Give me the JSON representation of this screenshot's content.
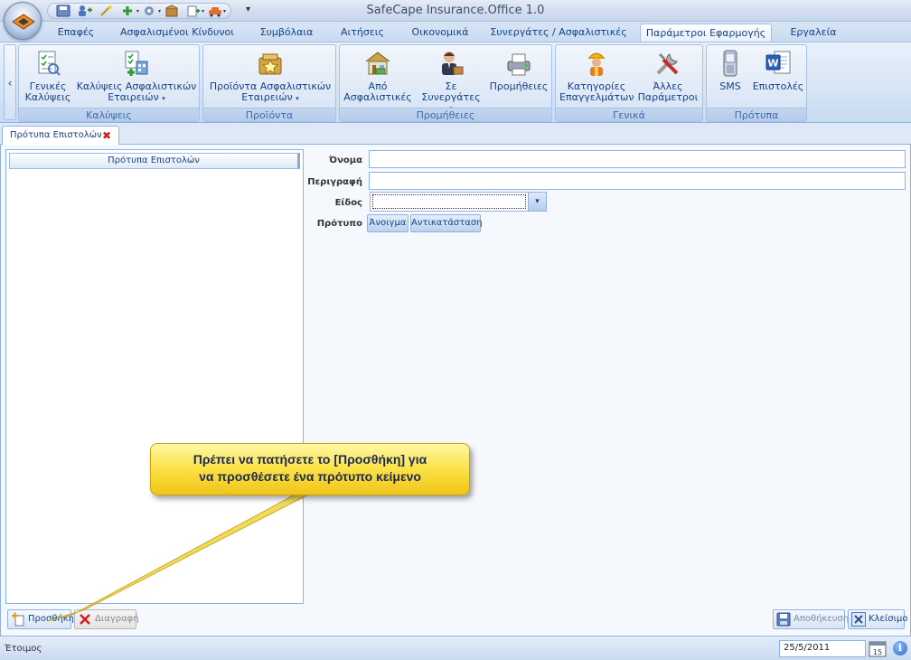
{
  "window": {
    "title": "SafeCape Insurance.Office 1.0"
  },
  "quick_access": {
    "items": [
      "save-icon",
      "users-add-icon",
      "wand-icon",
      "add-icon",
      "settings-icon",
      "box-icon",
      "document-add-icon",
      "car-icon"
    ],
    "menu_glyph": "▾"
  },
  "tabs": [
    {
      "label": "Επαφές"
    },
    {
      "label": "Ασφαλισμένοι Κίνδυνοι"
    },
    {
      "label": "Συμβόλαια"
    },
    {
      "label": "Αιτήσεις"
    },
    {
      "label": "Οικονομικά"
    },
    {
      "label": "Συνεργάτες / Ασφαλιστικές"
    },
    {
      "label": "Παράμετροι Εφαρμογής",
      "active": true
    },
    {
      "label": "Εργαλεία"
    }
  ],
  "ribbon": {
    "scroll_glyph": "‹",
    "groups": [
      {
        "label": "Καλύψεις",
        "buttons": [
          {
            "line1": "Γενικές",
            "line2": "Καλύψεις",
            "icon": "coverage-checklist-icon"
          },
          {
            "line1": "Καλύψεις Ασφαλιστικών",
            "line2": "Εταιρειών",
            "icon": "company-coverage-icon",
            "dropdown": "▾"
          }
        ]
      },
      {
        "label": "Προϊόντα",
        "buttons": [
          {
            "line1": "Προϊόντα Ασφαλιστικών",
            "line2": "Εταιρειών",
            "icon": "products-icon",
            "dropdown": "▾"
          }
        ]
      },
      {
        "label": "Προμήθειες",
        "buttons": [
          {
            "line1": "Από",
            "line2": "Ασφαλιστικές",
            "icon": "from-insurers-icon"
          },
          {
            "line1": "Σε Συνεργάτες",
            "line2": "",
            "icon": "to-partners-icon",
            "dropdown": "▾"
          },
          {
            "line1": "Προμήθειες",
            "line2": "",
            "icon": "commissions-icon"
          }
        ]
      },
      {
        "label": "Γενικά",
        "buttons": [
          {
            "line1": "Κατηγορίες",
            "line2": "Επαγγελμάτων",
            "icon": "professions-icon"
          },
          {
            "line1": "Άλλες",
            "line2": "Παράμετροι",
            "icon": "tools-icon"
          }
        ]
      },
      {
        "label": "Πρότυπα",
        "buttons": [
          {
            "line1": "SMS",
            "line2": "",
            "icon": "sms-icon"
          },
          {
            "line1": "Επιστολές",
            "line2": "",
            "icon": "word-letter-icon"
          }
        ]
      }
    ]
  },
  "document_tab": {
    "label": "Πρότυπα Επιστολών",
    "close_glyph": "✖"
  },
  "list": {
    "header": "Πρότυπα Επιστολών"
  },
  "form": {
    "name_label": "Όνομα",
    "name_value": "",
    "description_label": "Περιγραφή",
    "description_value": "",
    "type_label": "Είδος",
    "type_value": "",
    "type_dropdown": "▾",
    "template_label": "Πρότυπο",
    "open_button": "Άνοιγμα",
    "replace_button": "Αντικατάσταση"
  },
  "buttons": {
    "add": "Προσθήκη",
    "delete": "Διαγραφή",
    "save": "Αποθήκευση",
    "close": "Κλείσιμο"
  },
  "callout": {
    "text_line1": "Πρέπει να πατήσετε το [Προσθήκη] για",
    "text_line2": "να προσθέσετε ένα πρότυπο κείμενο"
  },
  "status": {
    "text": "Έτοιμος",
    "date": "25/5/2011",
    "calendar_day": "15",
    "info_glyph": "i"
  },
  "colors": {
    "accent": "#15428b",
    "callout": "#fbe245",
    "delete_red": "#d11f1f"
  }
}
